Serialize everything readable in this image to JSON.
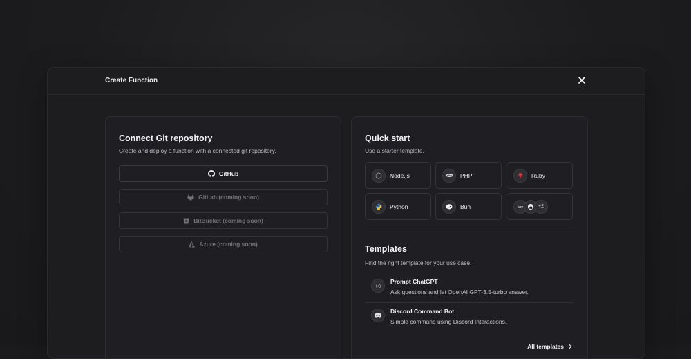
{
  "modal": {
    "title": "Create Function"
  },
  "git": {
    "title": "Connect Git repository",
    "subtitle": "Create and deploy a function with a connected git repository.",
    "providers": [
      {
        "label": "GitHub",
        "icon": "github-icon",
        "disabled": false
      },
      {
        "label": "GitLab (coming soon)",
        "icon": "gitlab-icon",
        "disabled": true
      },
      {
        "label": "BitBucket (coming soon)",
        "icon": "bitbucket-icon",
        "disabled": true
      },
      {
        "label": "Azure (coming soon)",
        "icon": "azure-icon",
        "disabled": true
      }
    ]
  },
  "quickstart": {
    "title": "Quick start",
    "subtitle": "Use a starter template.",
    "runtimes": [
      {
        "label": "Node.js",
        "icon": "nodejs-icon"
      },
      {
        "label": "PHP",
        "icon": "php-icon"
      },
      {
        "label": "Ruby",
        "icon": "ruby-icon"
      },
      {
        "label": "Python",
        "icon": "python-icon"
      },
      {
        "label": "Bun",
        "icon": "bun-icon"
      }
    ],
    "more": {
      "label": "+2",
      "icons": [
        "dotnet-icon",
        "deno-icon"
      ]
    }
  },
  "templates": {
    "title": "Templates",
    "subtitle": "Find the right template for your use case.",
    "items": [
      {
        "title": "Prompt ChatGPT",
        "description": "Ask questions and let OpenAI GPT-3.5-turbo answer.",
        "icon": "openai-icon"
      },
      {
        "title": "Discord Command Bot",
        "description": "Simple command using Discord Interactions.",
        "icon": "discord-icon"
      }
    ],
    "all_label": "All templates"
  },
  "colors": {
    "background": "#1c1c1e",
    "modal": "#1d1d20",
    "border": "#2c2c31",
    "text": "#ededf0",
    "muted": "#b8b8bf"
  }
}
